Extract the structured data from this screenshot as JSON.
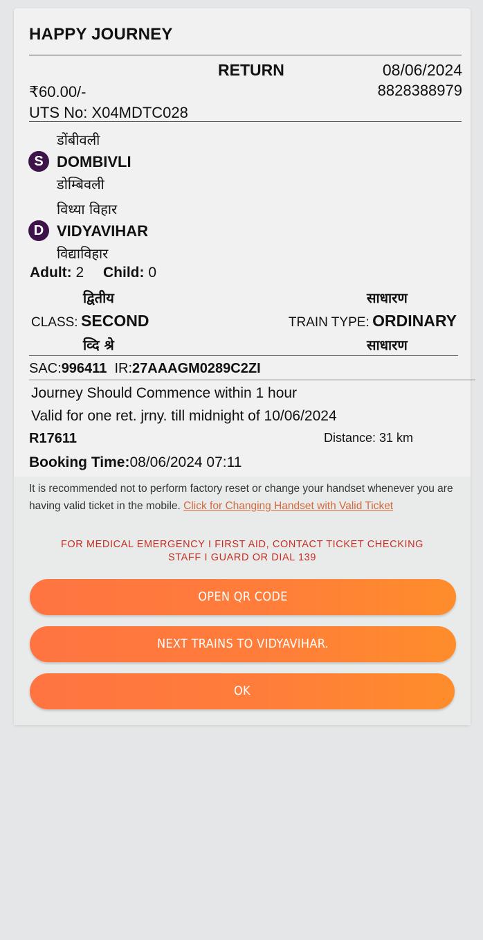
{
  "ticket": {
    "title": "HAPPY JOURNEY",
    "journey_type": "RETURN",
    "date": "08/06/2024",
    "fare": "₹60.00/-",
    "mobile": "8828388979",
    "uts_label": "UTS No: ",
    "uts_number": "X04MDTC028",
    "source": {
      "badge": "S",
      "hindi_top": "डोंबीवली",
      "name": "DOMBIVLI",
      "hindi_bottom": "डोम्बिवली"
    },
    "destination": {
      "badge": "D",
      "hindi_top": "विध्या विहार",
      "name": "VIDYAVIHAR",
      "hindi_bottom": "विद्याविहार"
    },
    "adult_label": "Adult:",
    "adult_count": "2",
    "child_label": "Child:",
    "child_count": "0",
    "class_hindi_top": "द्वितीय",
    "class_label": "CLASS:",
    "class_value": "SECOND",
    "class_hindi_bottom": "व्दि श्रे",
    "train_type_hindi_top": "साधारण",
    "train_type_label": "TRAIN TYPE:",
    "train_type_value": "ORDINARY",
    "train_type_hindi_bottom": "साधारण",
    "sac_label": "SAC:",
    "sac_value": "996411",
    "ir_label": "IR:",
    "ir_value": "27AAAGM0289C2ZI",
    "commence_note": "Journey Should Commence within 1 hour",
    "validity_note": "Valid for one ret. jrny. till midnight of 10/06/2024",
    "ticket_code": "R17611",
    "distance": "Distance: 31 km",
    "booking_label": "Booking Time:",
    "booking_time": "08/06/2024 07:11"
  },
  "notice": {
    "text": "It is recommended not to perform factory reset or change your handset whenever you are having valid ticket in the mobile. ",
    "link": "Click for Changing Handset with Valid Ticket",
    "emergency_line1": "FOR MEDICAL EMERGENCY I FIRST AID, CONTACT TICKET CHECKING",
    "emergency_line2": "STAFF I GUARD OR DIAL 139"
  },
  "buttons": {
    "open_qr": "OPEN QR CODE",
    "next_trains": "NEXT TRAINS TO VIDYAVIHAR.",
    "ok": "OK"
  },
  "colors": {
    "badge": "#3d1349",
    "button": "#ff7d3a",
    "emergency": "#c62e23",
    "link": "#d2693b"
  }
}
